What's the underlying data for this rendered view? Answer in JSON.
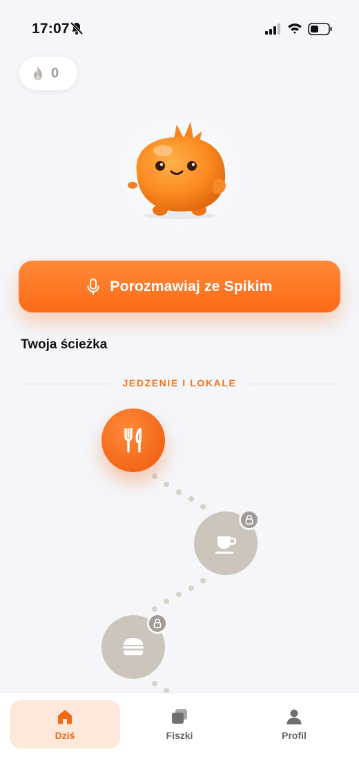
{
  "status_bar": {
    "time": "17:07"
  },
  "streak": {
    "count": "0",
    "icon": "flame-icon"
  },
  "cta": {
    "label": "Porozmawiaj ze Spikim",
    "icon": "mic-icon"
  },
  "path": {
    "title": "Twoja ścieżka",
    "category": "JEDZENIE I LOKALE",
    "nodes": [
      {
        "icon": "fork-knife-icon",
        "state": "active"
      },
      {
        "icon": "coffee-cup-icon",
        "state": "locked"
      },
      {
        "icon": "burger-icon",
        "state": "locked"
      }
    ]
  },
  "tabs": [
    {
      "label": "Dziś",
      "icon": "home-icon",
      "active": true
    },
    {
      "label": "Fiszki",
      "icon": "cards-icon",
      "active": false
    },
    {
      "label": "Profil",
      "icon": "profile-icon",
      "active": false
    }
  ],
  "colors": {
    "accent": "#fb6a16",
    "locked": "#cbc5bb",
    "background": "#f5f6fa"
  }
}
